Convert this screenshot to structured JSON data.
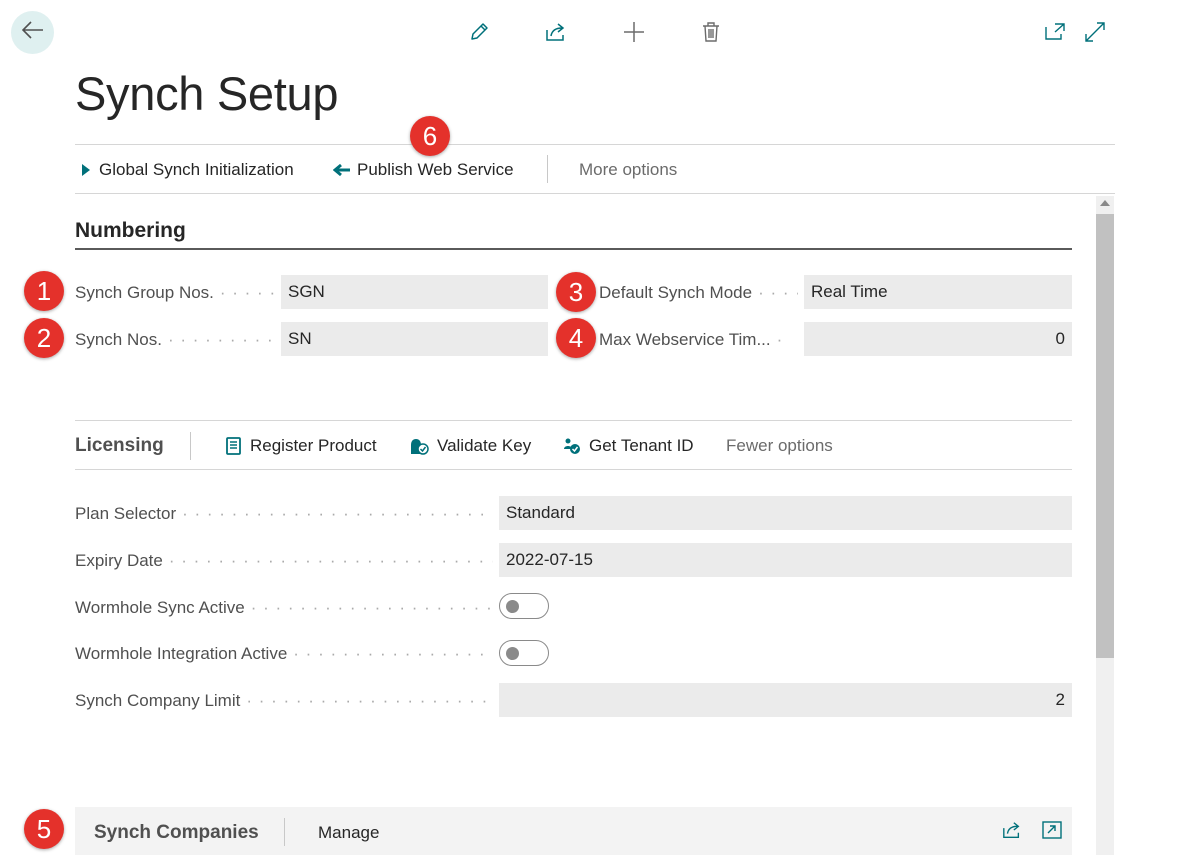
{
  "toolbar": {
    "back_icon": "back-arrow-icon",
    "icons": [
      "edit-icon",
      "share-icon",
      "new-icon",
      "delete-icon",
      "open-new-window-icon",
      "expand-icon"
    ]
  },
  "page": {
    "title": "Synch Setup"
  },
  "actions": {
    "global_sync": "Global Synch Initialization",
    "publish": "Publish Web Service",
    "more": "More options"
  },
  "badges": [
    "1",
    "2",
    "3",
    "4",
    "5",
    "6"
  ],
  "numbering": {
    "heading": "Numbering",
    "synch_group_nos": {
      "label": "Synch Group Nos.",
      "value": "SGN"
    },
    "synch_nos": {
      "label": "Synch Nos.",
      "value": "SN"
    },
    "default_synch_mode": {
      "label": "Default Synch Mode",
      "value": "Real Time"
    },
    "max_webservice": {
      "label": "Max Webservice Tim...",
      "value": "0"
    }
  },
  "licensing": {
    "heading": "Licensing",
    "register": "Register Product",
    "validate": "Validate Key",
    "tenant": "Get Tenant ID",
    "fewer": "Fewer options",
    "plan_selector": {
      "label": "Plan Selector",
      "value": "Standard"
    },
    "expiry_date": {
      "label": "Expiry Date",
      "value": "2022-07-15"
    },
    "wormhole_sync": {
      "label": "Wormhole Sync Active",
      "value": "off"
    },
    "wormhole_integration": {
      "label": "Wormhole Integration Active",
      "value": "off"
    },
    "company_limit": {
      "label": "Synch Company Limit",
      "value": "2"
    }
  },
  "synch_companies": {
    "heading": "Synch Companies",
    "manage": "Manage"
  },
  "colors": {
    "accent": "#00707a",
    "badge": "#e4312b",
    "field_bg": "#ebebeb"
  }
}
